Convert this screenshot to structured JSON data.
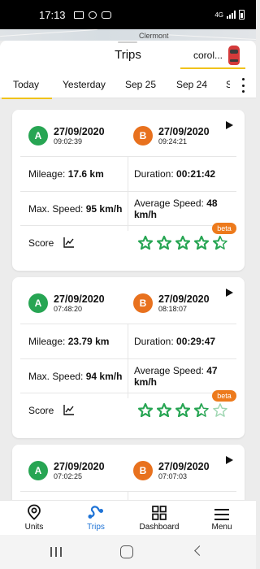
{
  "status_bar": {
    "time": "17:13",
    "network": "4G"
  },
  "map": {
    "place_label": "Clermont"
  },
  "header": {
    "title": "Trips",
    "unit_name": "corol..."
  },
  "tabs": [
    {
      "label": "Today",
      "active": true
    },
    {
      "label": "Yesterday",
      "active": false
    },
    {
      "label": "Sep 25",
      "active": false
    },
    {
      "label": "Sep 24",
      "active": false
    },
    {
      "label": "S",
      "active": false
    }
  ],
  "trips": [
    {
      "start_marker": "A",
      "start_date": "27/09/2020",
      "start_time": "09:02:39",
      "end_marker": "B",
      "end_date": "27/09/2020",
      "end_time": "09:24:21",
      "mileage_label": "Mileage:",
      "mileage": "17.6 km",
      "duration_label": "Duration:",
      "duration": "00:21:42",
      "max_speed_label": "Max. Speed:",
      "max_speed": "95 km/h",
      "avg_speed_label": "Average Speed:",
      "avg_speed": "48 km/h",
      "score_label": "Score",
      "beta_label": "beta",
      "score_stars": 4.5
    },
    {
      "start_marker": "A",
      "start_date": "27/09/2020",
      "start_time": "07:48:20",
      "end_marker": "B",
      "end_date": "27/09/2020",
      "end_time": "08:18:07",
      "mileage_label": "Mileage:",
      "mileage": "23.79 km",
      "duration_label": "Duration:",
      "duration": "00:29:47",
      "max_speed_label": "Max. Speed:",
      "max_speed": "94 km/h",
      "avg_speed_label": "Average Speed:",
      "avg_speed": "47 km/h",
      "score_label": "Score",
      "beta_label": "beta",
      "score_stars": 3.5
    },
    {
      "start_marker": "A",
      "start_date": "27/09/2020",
      "start_time": "07:02:25",
      "end_marker": "B",
      "end_date": "27/09/2020",
      "end_time": "07:07:03"
    }
  ],
  "bottom_nav": [
    {
      "label": "Units",
      "icon": "map-pin-icon",
      "active": false
    },
    {
      "label": "Trips",
      "icon": "route-icon",
      "active": true
    },
    {
      "label": "Dashboard",
      "icon": "grid-icon",
      "active": false
    },
    {
      "label": "Menu",
      "icon": "hamburger-icon",
      "active": false
    }
  ],
  "colors": {
    "accent": "#f0c21b",
    "start": "#27a553",
    "end": "#e8711e",
    "active_nav": "#1e73d6",
    "star": "#27a553",
    "beta": "#ed7a1c"
  }
}
